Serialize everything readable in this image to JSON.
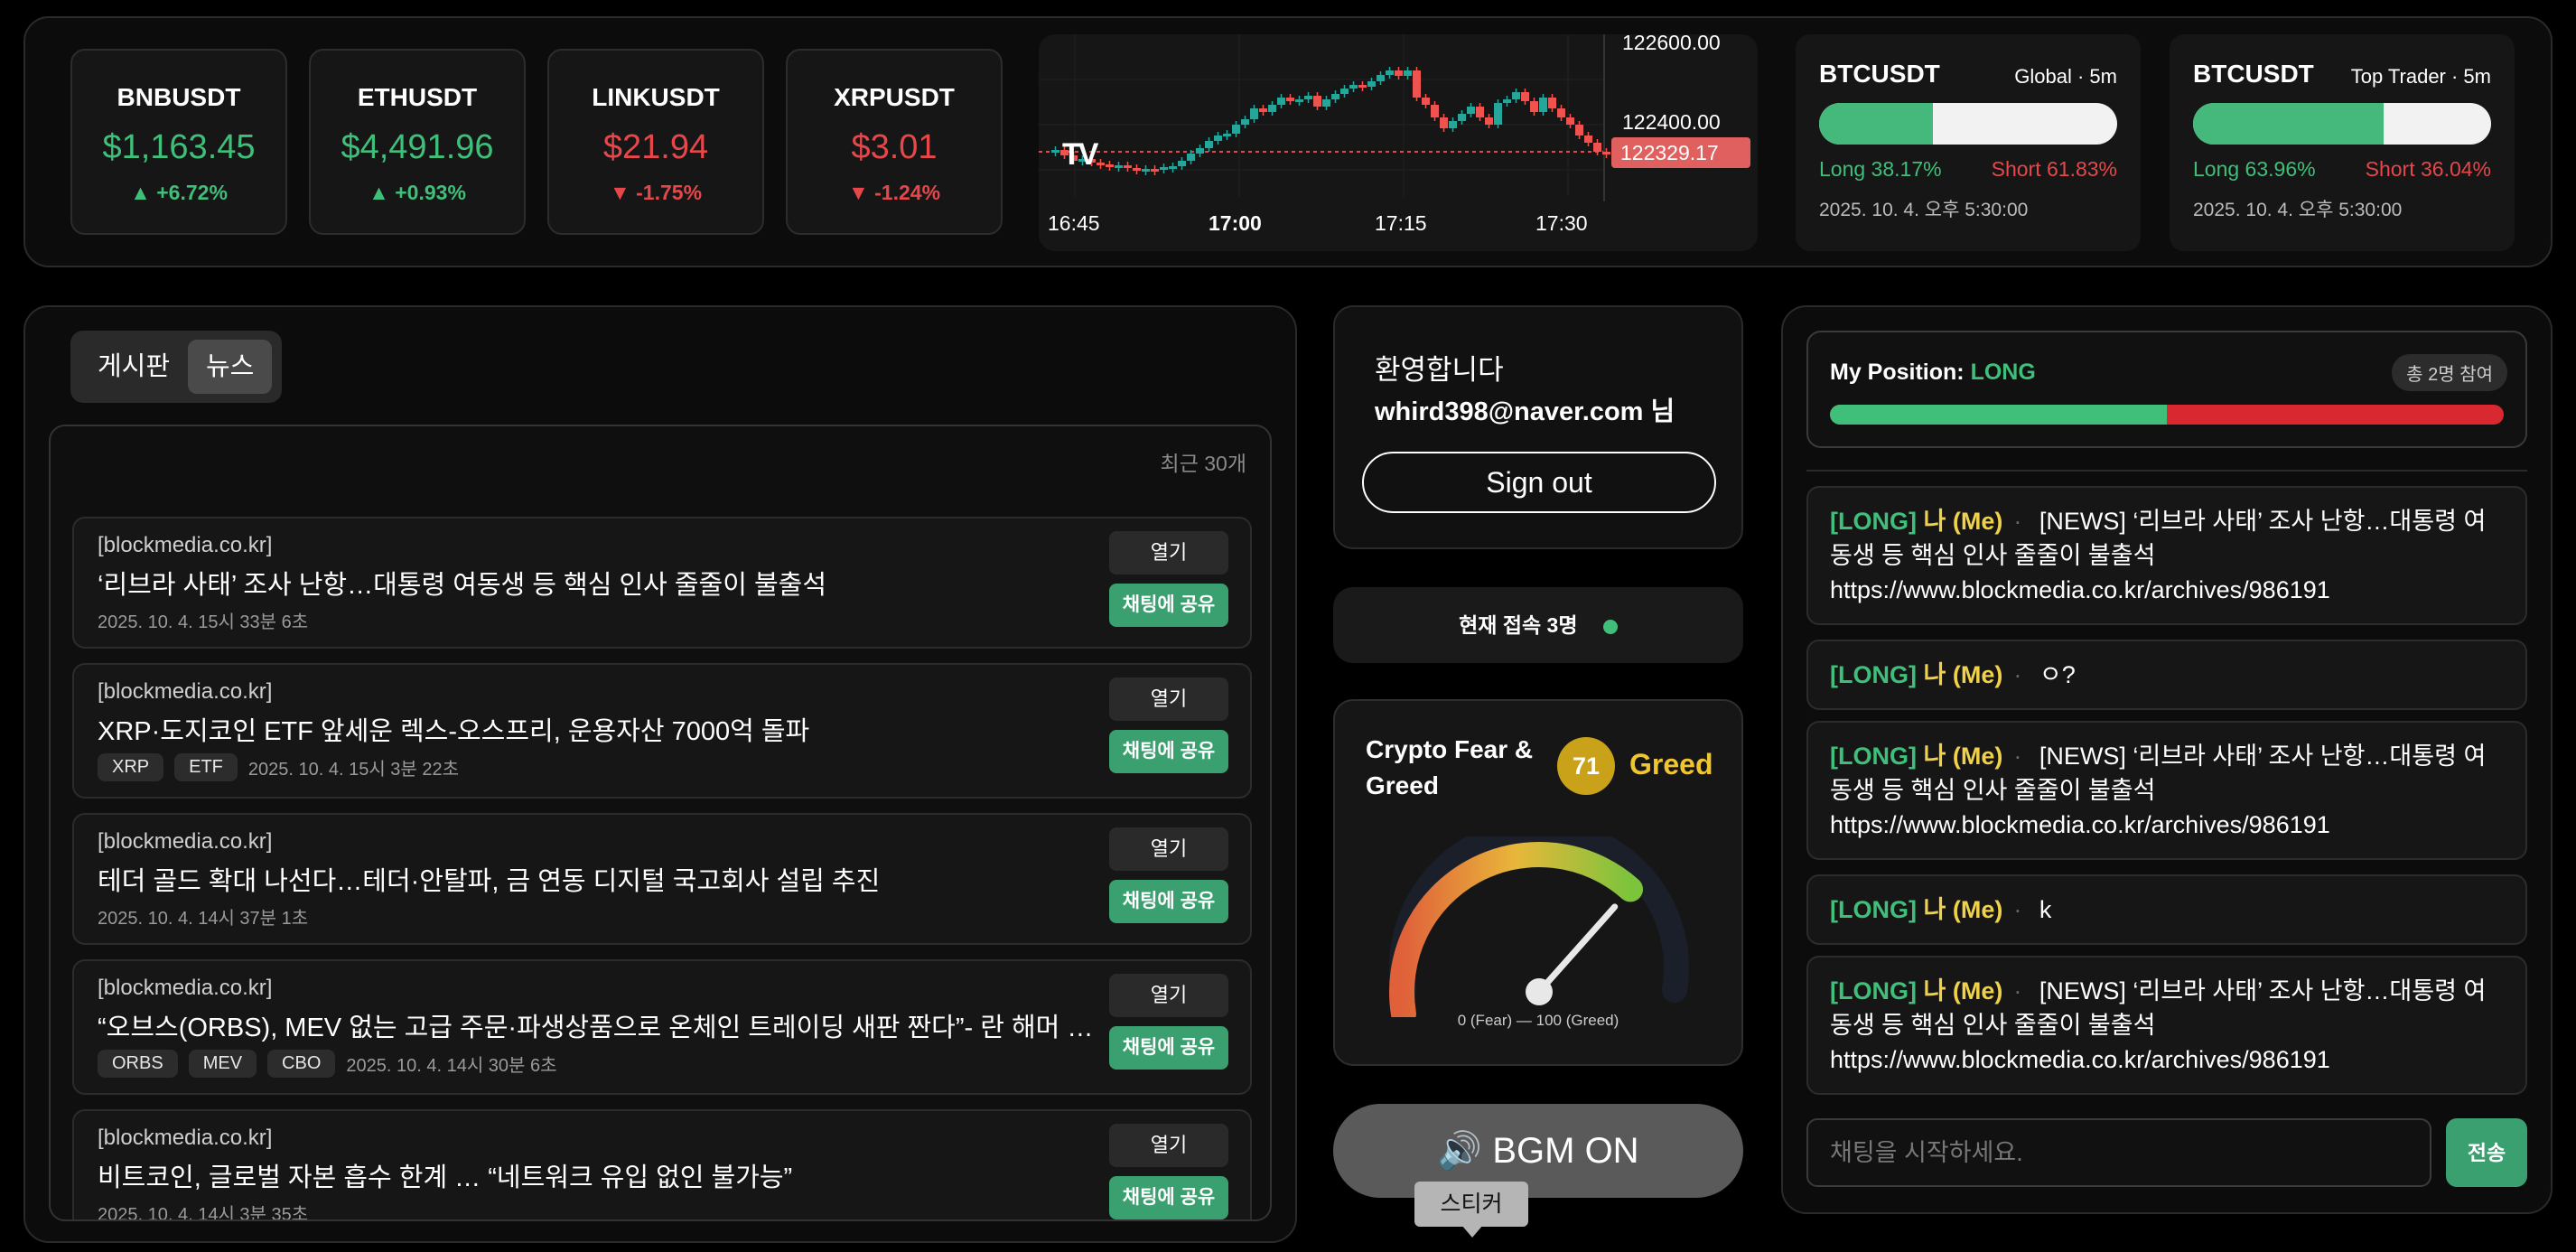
{
  "tickers": [
    {
      "symbol": "BNBUSDT",
      "price": "$1,163.45",
      "change": "▲ +6.72%",
      "dir": "up"
    },
    {
      "symbol": "ETHUSDT",
      "price": "$4,491.96",
      "change": "▲ +0.93%",
      "dir": "up"
    },
    {
      "symbol": "LINKUSDT",
      "price": "$21.94",
      "change": "▼ -1.75%",
      "dir": "down"
    },
    {
      "symbol": "XRPUSDT",
      "price": "$3.01",
      "change": "▼ -1.24%",
      "dir": "down"
    }
  ],
  "mini_chart": {
    "price_labels": [
      "122600.00",
      "122400.00"
    ],
    "current_price": "122329.17",
    "time_labels": [
      "16:45",
      "17:00",
      "17:15",
      "17:30"
    ],
    "logo_text": "TV"
  },
  "ratios": [
    {
      "symbol": "BTCUSDT",
      "label": "Global · 5m",
      "long": "Long 38.17%",
      "short": "Short 61.83%",
      "long_fraction": 0.3817,
      "timestamp": "2025. 10. 4. 오후 5:30:00"
    },
    {
      "symbol": "BTCUSDT",
      "label": "Top Trader · 5m",
      "long": "Long 63.96%",
      "short": "Short 36.04%",
      "long_fraction": 0.6396,
      "timestamp": "2025. 10. 4. 오후 5:30:00"
    }
  ],
  "tabs": {
    "board": "게시판",
    "news": "뉴스"
  },
  "news": {
    "recent_label": "최근 30개",
    "open_label": "열기",
    "share_label": "채팅에 공유",
    "items": [
      {
        "source": "[blockmedia.co.kr]",
        "title": "‘리브라 사태’ 조사 난항…대통령 여동생 등 핵심 인사 줄줄이 불출석",
        "tags": [],
        "time": "2025. 10. 4. 15시 33분 6초"
      },
      {
        "source": "[blockmedia.co.kr]",
        "title": "XRP·도지코인 ETF 앞세운 렉스-오스프리, 운용자산 7000억 돌파",
        "tags": [
          "XRP",
          "ETF"
        ],
        "time": "2025. 10. 4. 15시 3분 22초"
      },
      {
        "source": "[blockmedia.co.kr]",
        "title": "테더 골드 확대 나선다…테더·안탈파, 금 연동 디지털 국고회사 설립 추진",
        "tags": [],
        "time": "2025. 10. 4. 14시 37분 1초"
      },
      {
        "source": "[blockmedia.co.kr]",
        "title": "“오브스(ORBS), MEV 없는 고급 주문·파생상품으로 온체인 트레이딩 새판 짠다”- 란 해머 오브스 …",
        "tags": [
          "ORBS",
          "MEV",
          "CBO"
        ],
        "time": "2025. 10. 4. 14시 30분 6초"
      },
      {
        "source": "[blockmedia.co.kr]",
        "title": "비트코인, 글로벌 자본 흡수 한계 … “네트워크 유입 없인 불가능”",
        "tags": [],
        "time": "2025. 10. 4. 14시 3분 35초"
      }
    ]
  },
  "welcome": {
    "greeting": "환영합니다",
    "user": "whird398@naver.com 님",
    "signout": "Sign out"
  },
  "online": {
    "text": "현재 접속 3명"
  },
  "fear_greed": {
    "title_line1": "Crypto Fear &",
    "title_line2": "Greed",
    "value": "71",
    "value_number": 71,
    "label": "Greed",
    "scale": "0 (Fear) — 100 (Greed)"
  },
  "bgm": {
    "label": "🔊 BGM ON",
    "tooltip": "스티커"
  },
  "position": {
    "prefix": "My Position:",
    "side": "LONG",
    "participants": "총 2명 참여",
    "long_fraction": 0.5
  },
  "chat": {
    "messages": [
      {
        "tag": "[LONG]",
        "who": "나 (Me)",
        "text": "[NEWS] ‘리브라 사태’ 조사 난항…대통령 여동생 등 핵심 인사 줄줄이 불출석",
        "link": "https://www.blockmedia.co.kr/archives/986191"
      },
      {
        "tag": "[LONG]",
        "who": "나 (Me)",
        "text": "ㅇ?",
        "link": ""
      },
      {
        "tag": "[LONG]",
        "who": "나 (Me)",
        "text": "[NEWS] ‘리브라 사태’ 조사 난항…대통령 여동생 등 핵심 인사 줄줄이 불출석",
        "link": "https://www.blockmedia.co.kr/archives/986191"
      },
      {
        "tag": "[LONG]",
        "who": "나 (Me)",
        "text": "k",
        "link": ""
      },
      {
        "tag": "[LONG]",
        "who": "나 (Me)",
        "text": "[NEWS] ‘리브라 사태’ 조사 난항…대통령 여동생 등 핵심 인사 줄줄이 불출석",
        "link": "https://www.blockmedia.co.kr/archives/986191"
      }
    ],
    "placeholder": "채팅을 시작하세요.",
    "send_label": "전송"
  },
  "colors": {
    "up": "#3fbf7a",
    "down": "#e5474b",
    "me": "#f0d24a",
    "fg_badge": "#c9a21a"
  }
}
